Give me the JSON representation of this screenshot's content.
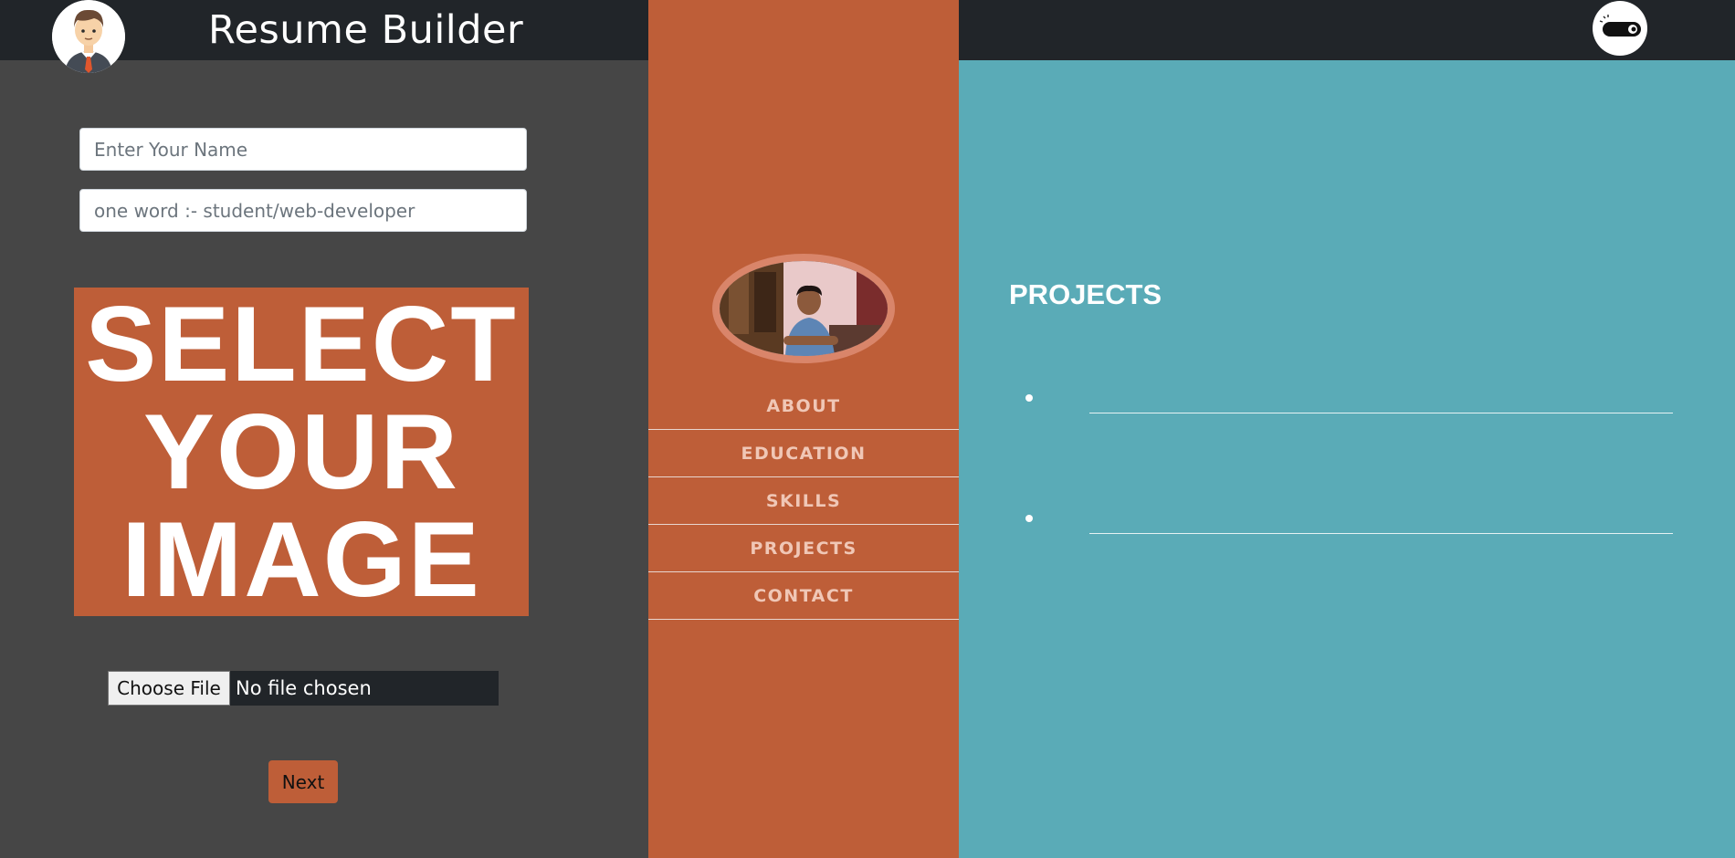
{
  "header": {
    "title": "Resume Builder",
    "logo_icon": "user-avatar-icon"
  },
  "form": {
    "name_placeholder": "Enter Your Name",
    "role_placeholder": "one word :- student/web-developer",
    "select_image_lines": [
      "SELECT",
      "YOUR",
      "IMAGE"
    ],
    "choose_file_label": "Choose File",
    "file_status": "No file chosen",
    "next_label": "Next"
  },
  "nav": {
    "items": [
      "ABOUT",
      "EDUCATION",
      "SKILLS",
      "PROJECTS",
      "CONTACT"
    ]
  },
  "preview": {
    "section_heading": "PROJECTS",
    "project_items": [
      "",
      ""
    ]
  },
  "theme_toggle": {
    "icon": "dark-mode-toggle-icon"
  },
  "colors": {
    "accent": "#be5e38",
    "left_panel_bg": "#464646",
    "topbar_bg": "#212529",
    "preview_bg": "#5aabb7"
  }
}
